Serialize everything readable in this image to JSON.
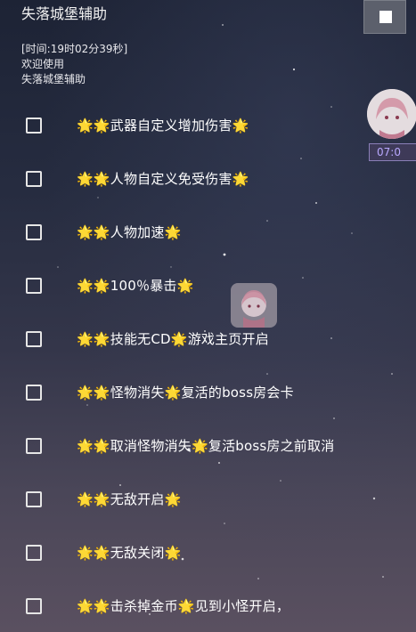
{
  "panel": {
    "title": "失落城堡辅助",
    "info_lines": [
      "[时间:19时02分39秒]",
      "欢迎使用",
      "失落城堡辅助"
    ]
  },
  "star_glyph": "🌟",
  "options": [
    [
      "",
      "武器自定义增加伤害",
      ""
    ],
    [
      "",
      "人物自定义免受伤害",
      ""
    ],
    [
      "",
      "人物加速",
      ""
    ],
    [
      "",
      "100％暴击",
      ""
    ],
    [
      "",
      "技能无CD",
      "游戏主页开启"
    ],
    [
      "",
      "怪物消失",
      "复活的boss房会卡"
    ],
    [
      "",
      "取消怪物消失",
      "复活boss房之前取消"
    ],
    [
      "",
      "无敌开启",
      ""
    ],
    [
      "",
      "无敌关闭",
      ""
    ],
    [
      "",
      "击杀掉金币",
      "见到小怪开启，"
    ]
  ],
  "side_widget": {
    "time": "07:0"
  },
  "colors": {
    "star": "#f5c527",
    "stop_button": "#5c606c",
    "time_text": "#b9a8ff"
  }
}
